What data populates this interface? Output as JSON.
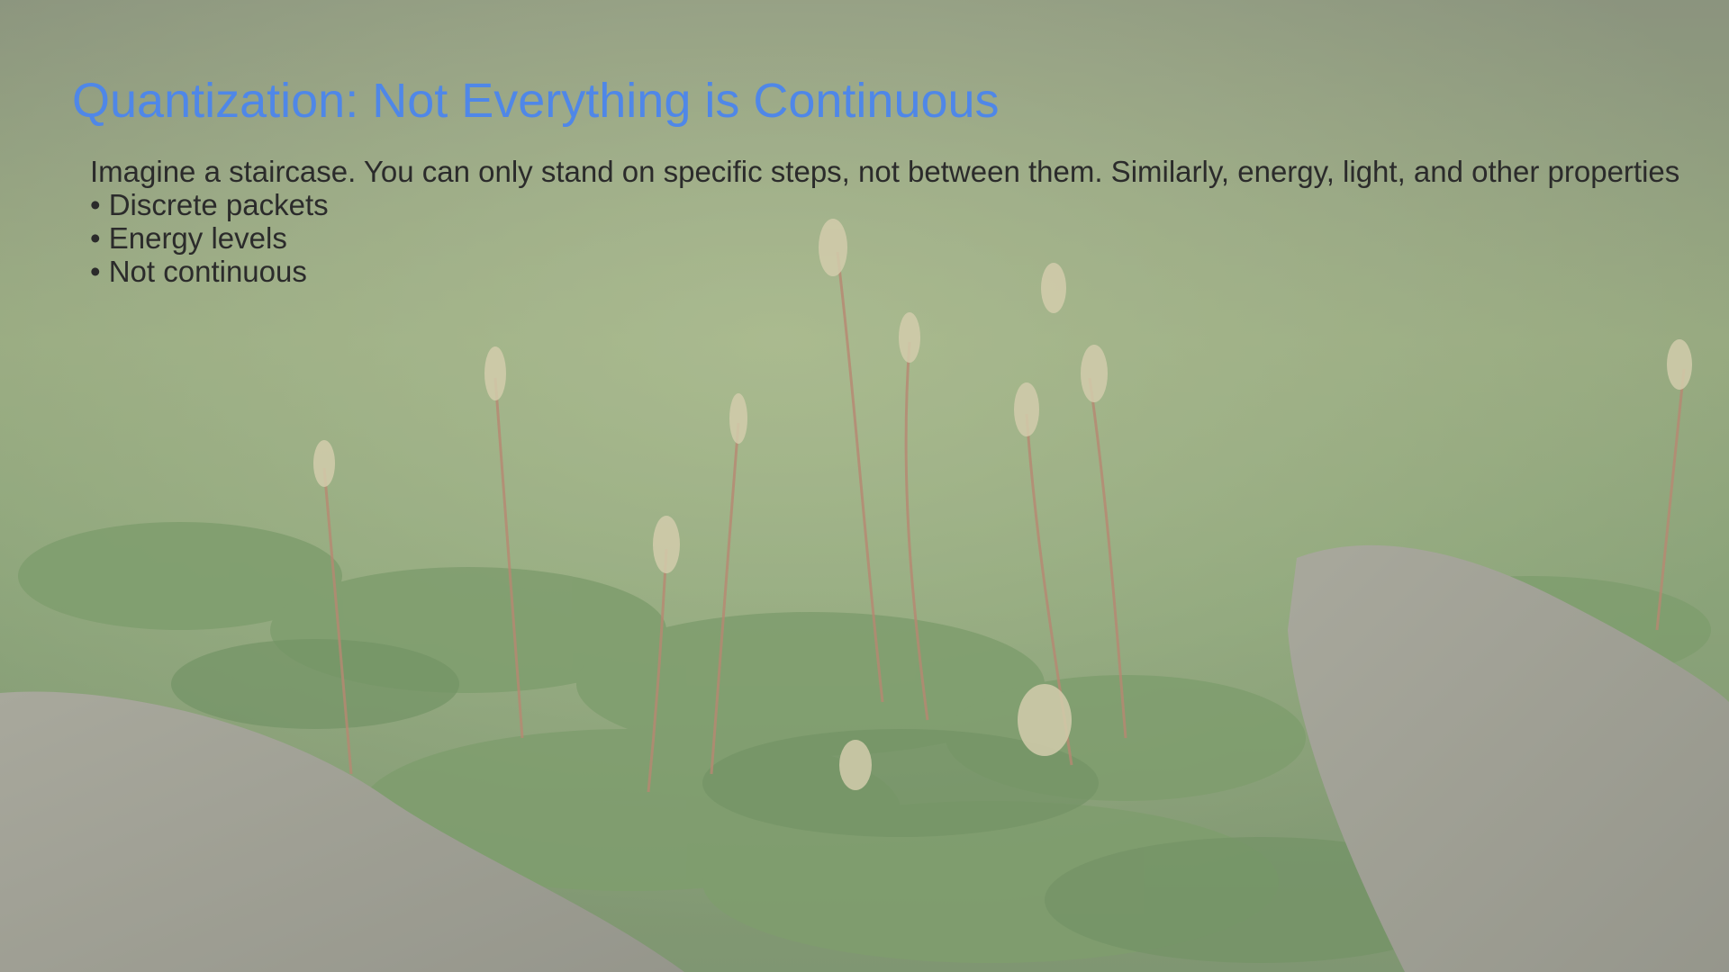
{
  "slide": {
    "title": "Quantization: Not Everything is Continuous",
    "intro": "Imagine a staircase. You can only stand on specific steps, not between them.  Similarly, energy, light, and other properties",
    "bullets": [
      "• Discrete packets",
      "• Energy levels",
      "• Not continuous"
    ]
  },
  "colors": {
    "title": "#4f87e8",
    "body_text": "#2b2b2b"
  },
  "background": {
    "subject": "moss-sprouts-photo"
  }
}
